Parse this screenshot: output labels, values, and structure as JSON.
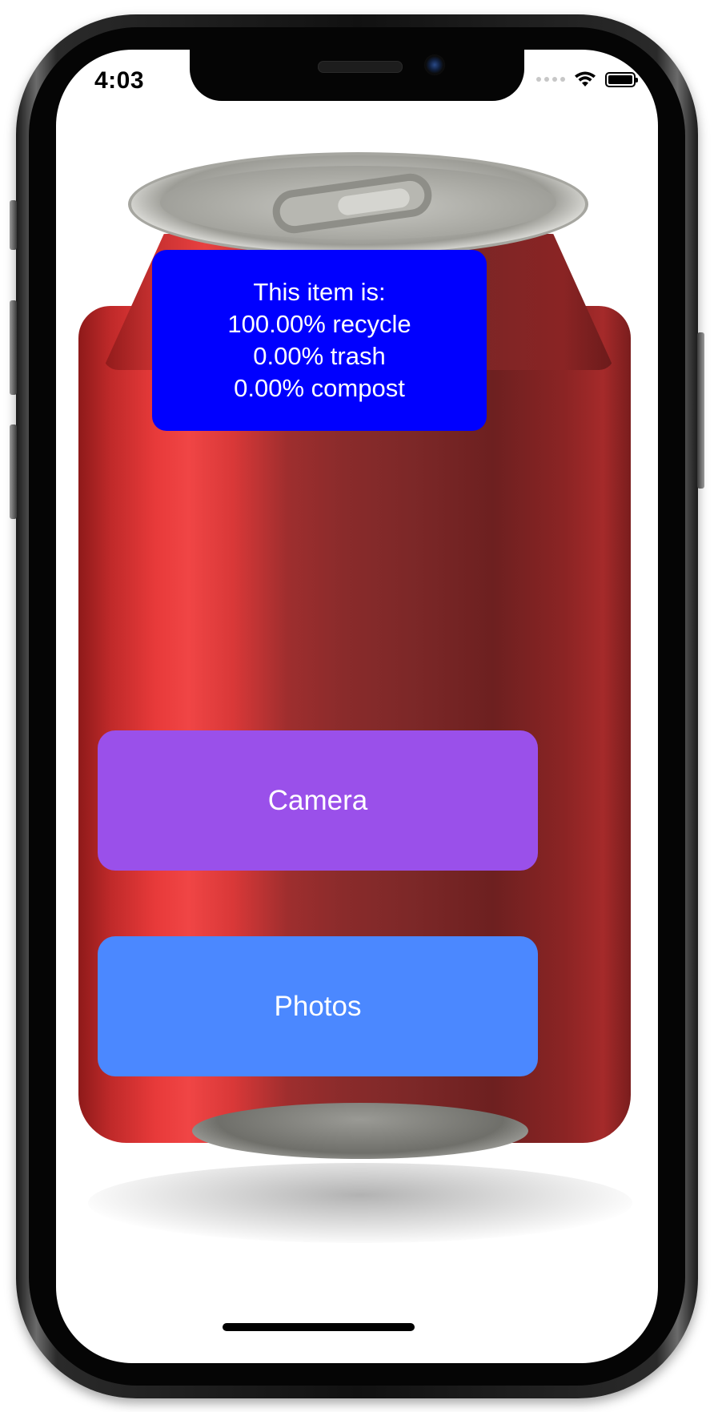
{
  "status_bar": {
    "time": "4:03",
    "wifi_icon": "wifi-icon",
    "battery_icon": "battery-icon",
    "signal_icon": "signal-dots-icon"
  },
  "background_image": {
    "subject": "aluminum-soda-can",
    "color": "#d33535"
  },
  "result": {
    "heading": "This item is:",
    "recycle": "100.00% recycle",
    "trash": "0.00% trash",
    "compost": "0.00% compost",
    "background_color": "#0000ff"
  },
  "buttons": {
    "camera_label": "Camera",
    "camera_color": "#9a50ea",
    "photos_label": "Photos",
    "photos_color": "#4b88ff"
  }
}
